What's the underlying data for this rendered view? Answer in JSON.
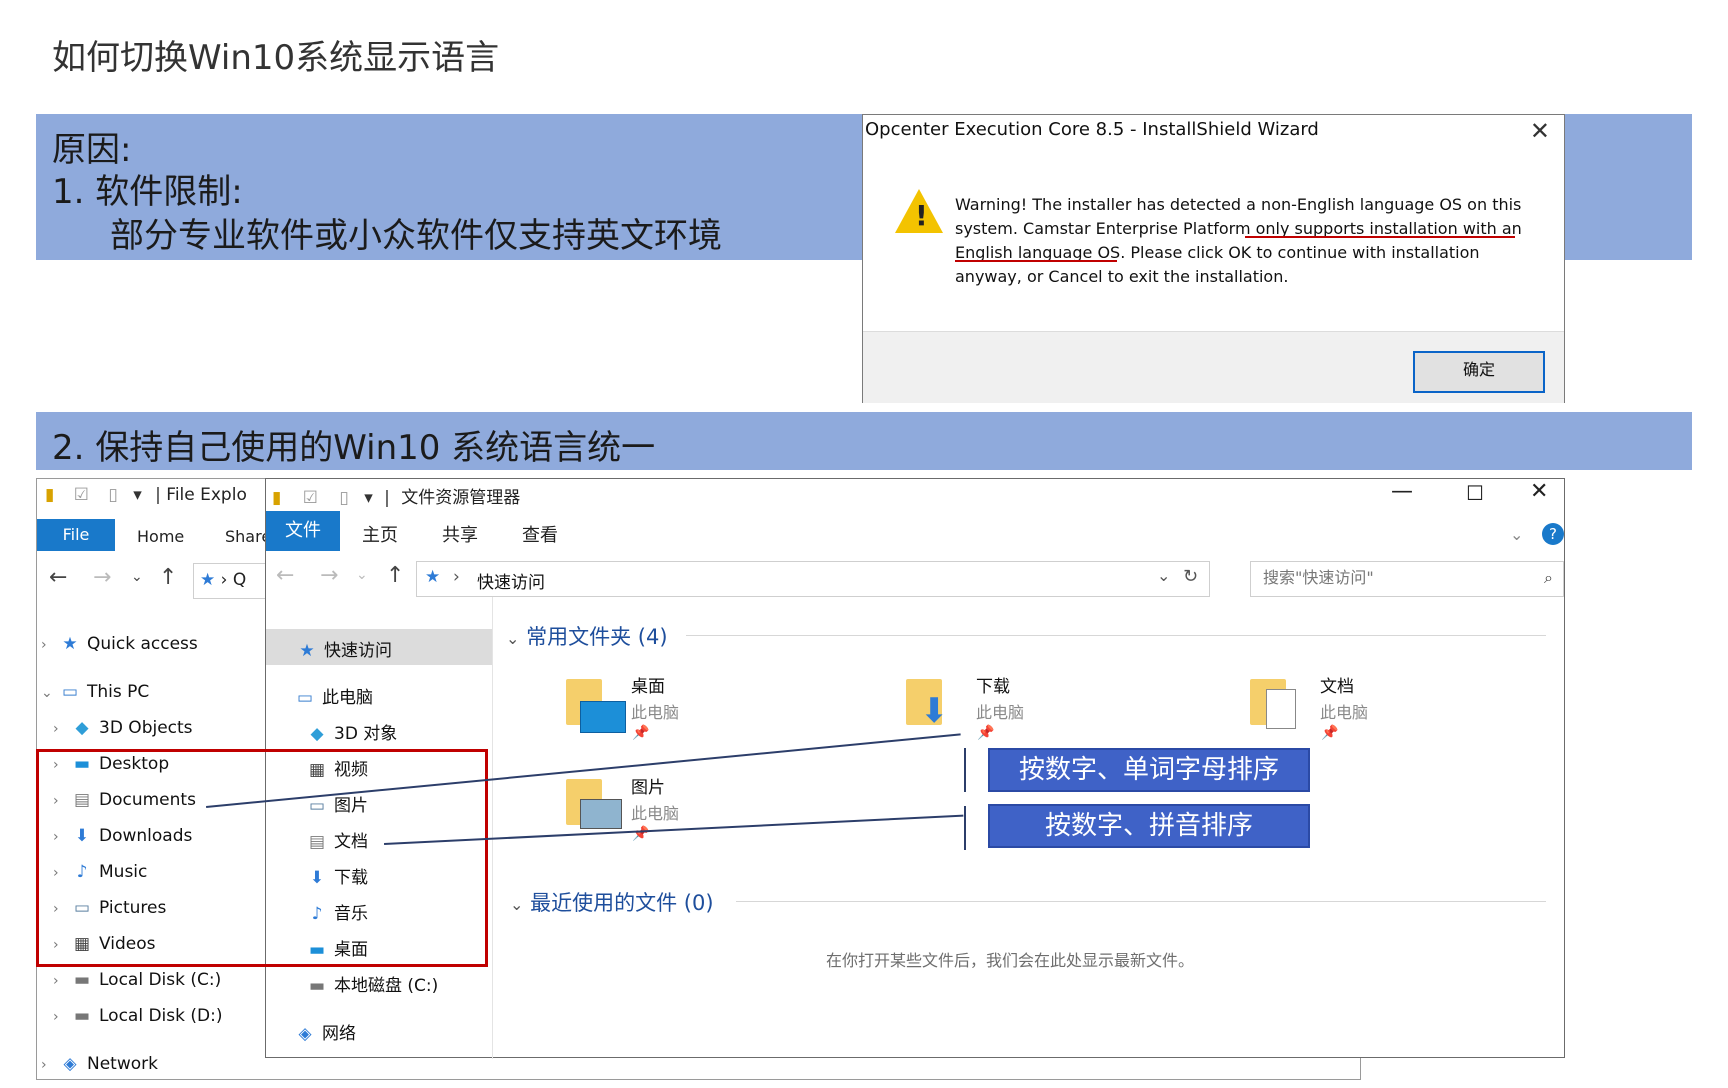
{
  "slide": {
    "title": "如何切换Win10系统显示语言",
    "reason_heading": "原因:",
    "reason_item_1": "1.   软件限制:",
    "reason_item_1_detail": "部分专业软件或小众软件仅支持英文环境",
    "reason_item_2": "2.  保持自己使用的Win10 系统语言统一",
    "band_color": "#8faadc"
  },
  "dialog": {
    "title": "Opcenter Execution Core 8.5 - InstallShield Wizard",
    "close_glyph": "✕",
    "warning_icon": "warning-icon",
    "message_lines": [
      "Warning! The installer has detected a non-English language OS on this",
      "system. Camstar Enterprise Platform only supports installation with an",
      "English language OS. Please click OK to continue with installation",
      "anyway, or Cancel to exit the installation."
    ],
    "ok_label": "确定"
  },
  "explorer_en": {
    "qat_title": "File Explo",
    "tabs": [
      "File",
      "Home",
      "Share"
    ],
    "address_fragment": "Q",
    "nav": [
      {
        "label": "Quick access",
        "icon": "star-icon"
      },
      {
        "label": "This PC",
        "icon": "pc-icon"
      },
      {
        "label": "3D Objects",
        "icon": "cube-icon"
      },
      {
        "label": "Desktop",
        "icon": "desktop-icon"
      },
      {
        "label": "Documents",
        "icon": "document-icon"
      },
      {
        "label": "Downloads",
        "icon": "download-icon"
      },
      {
        "label": "Music",
        "icon": "music-icon"
      },
      {
        "label": "Pictures",
        "icon": "picture-icon"
      },
      {
        "label": "Videos",
        "icon": "video-icon"
      },
      {
        "label": "Local Disk (C:)",
        "icon": "disk-icon"
      },
      {
        "label": "Local Disk (D:)",
        "icon": "disk-icon"
      },
      {
        "label": "Network",
        "icon": "network-icon"
      }
    ]
  },
  "explorer_cn": {
    "window_title": "文件资源管理器",
    "tabs": [
      "文件",
      "主页",
      "共享",
      "查看"
    ],
    "address_path": "快速访问",
    "search_placeholder": "搜索\"快速访问\"",
    "nav": [
      {
        "label": "快速访问",
        "icon": "star-icon"
      },
      {
        "label": "此电脑",
        "icon": "pc-icon"
      },
      {
        "label": "3D 对象",
        "icon": "cube-icon"
      },
      {
        "label": "视频",
        "icon": "video-icon"
      },
      {
        "label": "图片",
        "icon": "picture-icon"
      },
      {
        "label": "文档",
        "icon": "document-icon"
      },
      {
        "label": "下载",
        "icon": "download-icon"
      },
      {
        "label": "音乐",
        "icon": "music-icon"
      },
      {
        "label": "桌面",
        "icon": "desktop-icon"
      },
      {
        "label": "本地磁盘 (C:)",
        "icon": "disk-icon"
      },
      {
        "label": "网络",
        "icon": "network-icon"
      }
    ],
    "frequent_group": "常用文件夹 (4)",
    "folders": [
      {
        "name": "桌面",
        "location": "此电脑"
      },
      {
        "name": "下载",
        "location": "此电脑"
      },
      {
        "name": "文档",
        "location": "此电脑"
      },
      {
        "name": "图片",
        "location": "此电脑"
      }
    ],
    "recent_group": "最近使用的文件 (0)",
    "recent_empty": "在你打开某些文件后，我们会在此处显示最新文件。"
  },
  "callouts": {
    "en_sort": "按数字、单词字母排序",
    "cn_sort": "按数字、拼音排序"
  },
  "colors": {
    "accent_blue": "#1979ca",
    "callout_blue": "#3f62c7",
    "highlight_red": "#c00000"
  }
}
